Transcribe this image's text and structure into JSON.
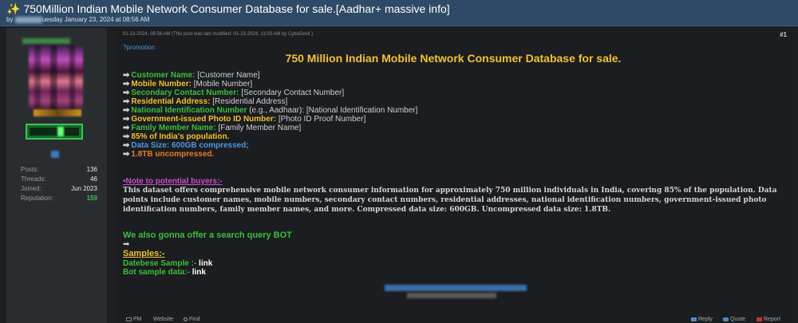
{
  "thread": {
    "title_icon": "sparkles-icon",
    "title": "750Million Indian Mobile Network Consumer Database for sale.[Aadhar+ massive info]",
    "by_prefix": "by",
    "date": "uesday January 23, 2024 at 08:56 AM"
  },
  "author": {
    "stats": [
      {
        "label": "Posts:",
        "value": "136"
      },
      {
        "label": "Threads:",
        "value": "46"
      },
      {
        "label": "Joined:",
        "value": "Jun 2023"
      },
      {
        "label": "Reputation:",
        "value": "159"
      }
    ]
  },
  "post": {
    "date_line": "01-23-2024, 08:56 AM  (This post was last modified: 01-23-2024, 11:03 AM by CyboDevil.)",
    "number": "#1",
    "promo": "?promotion",
    "heading": "750 Million Indian Mobile Network Consumer Database for sale.",
    "fields": [
      {
        "label": "Customer Name:",
        "value": "[Customer Name]",
        "color": "#3cbf3c"
      },
      {
        "label": "Mobile Number:",
        "value": "[Mobile Number]",
        "color": "#f1c232"
      },
      {
        "label": "Secondary Contact Number:",
        "value": "[Secondary Contact Number]",
        "color": "#3cbf3c"
      },
      {
        "label": "Residential Address:",
        "value": "[Residential Address]",
        "color": "#f1c232"
      },
      {
        "label": "National Identification Number",
        "value": "(e.g., Aadhaar): [National Identification Number]",
        "color": "#3cbf3c"
      },
      {
        "label": "Government-issued Photo ID Number:",
        "value": "[Photo ID Proof Number]",
        "color": "#f1c232"
      },
      {
        "label": "Family Member Name:",
        "value": "[Family Member Name]",
        "color": "#3cbf3c"
      },
      {
        "label": "85% of India's population.",
        "value": "",
        "color": "#f1c232"
      },
      {
        "label": "Data Size: 600GB compressed;",
        "value": "",
        "color": "#4f96de"
      },
      {
        "label": "1.8TB uncompressed.",
        "value": "",
        "color": "#e67e22"
      }
    ],
    "note_title": "•Note to potential buyers:-",
    "description": "This dataset offers comprehensive mobile network consumer information for approximately 750 million individuals in India, covering 85% of the population. Data points include customer names, mobile numbers, secondary contact numbers, residential addresses, national identification numbers, government-issued photo identification numbers, family member names, and more. Compressed data size: 600GB. Uncompressed data size: 1.8TB.",
    "bot_line": "We also gonna offer a search query BOT",
    "arrow": "➡",
    "samples_heading": "Samples:-",
    "samples": [
      {
        "label": "Datebese Sample :-",
        "link": "link"
      },
      {
        "label": "Bot sample data:-",
        "link": "link"
      }
    ]
  },
  "footer": {
    "pm": "PM",
    "website": "Website",
    "find": "Find",
    "reply": "Reply",
    "quote": "Quote",
    "report": "Report"
  }
}
